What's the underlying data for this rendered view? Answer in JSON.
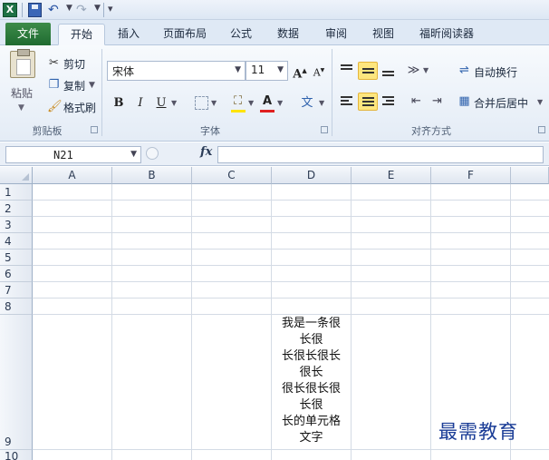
{
  "app": {
    "app_icon": "X"
  },
  "tabs": [
    "文件",
    "开始",
    "插入",
    "页面布局",
    "公式",
    "数据",
    "审阅",
    "视图",
    "福昕阅读器"
  ],
  "active_tab": "开始",
  "clipboard": {
    "paste": "粘贴",
    "cut": "剪切",
    "copy": "复制",
    "format_painter": "格式刷",
    "label": "剪贴板"
  },
  "font": {
    "name": "宋体",
    "size": "11",
    "grow": "A",
    "shrink": "A",
    "bold": "B",
    "italic": "I",
    "underline": "U",
    "color_letter": "A",
    "phonetic": "文",
    "label": "字体"
  },
  "alignment": {
    "wrap_text": "自动换行",
    "merge_center": "合并后居中",
    "label": "对齐方式"
  },
  "formula_bar": {
    "name_box": "N21",
    "fx": "fx",
    "formula": ""
  },
  "columns": [
    "A",
    "B",
    "C",
    "D",
    "E",
    "F"
  ],
  "rows": [
    "1",
    "2",
    "3",
    "4",
    "5",
    "6",
    "7",
    "8",
    "9",
    "10"
  ],
  "cell_D9": {
    "lines": [
      "我是一条很",
      "长很",
      "长很长很长",
      "很长",
      "很长很长很",
      "长很",
      "长的单元格",
      "文字"
    ]
  },
  "watermark": "最需教育",
  "colors": {
    "file_tab": "#2a7a3b",
    "highlight": "#fde67e",
    "font_color_bar": "#e02020",
    "fill_color_bar": "#ffe400"
  }
}
